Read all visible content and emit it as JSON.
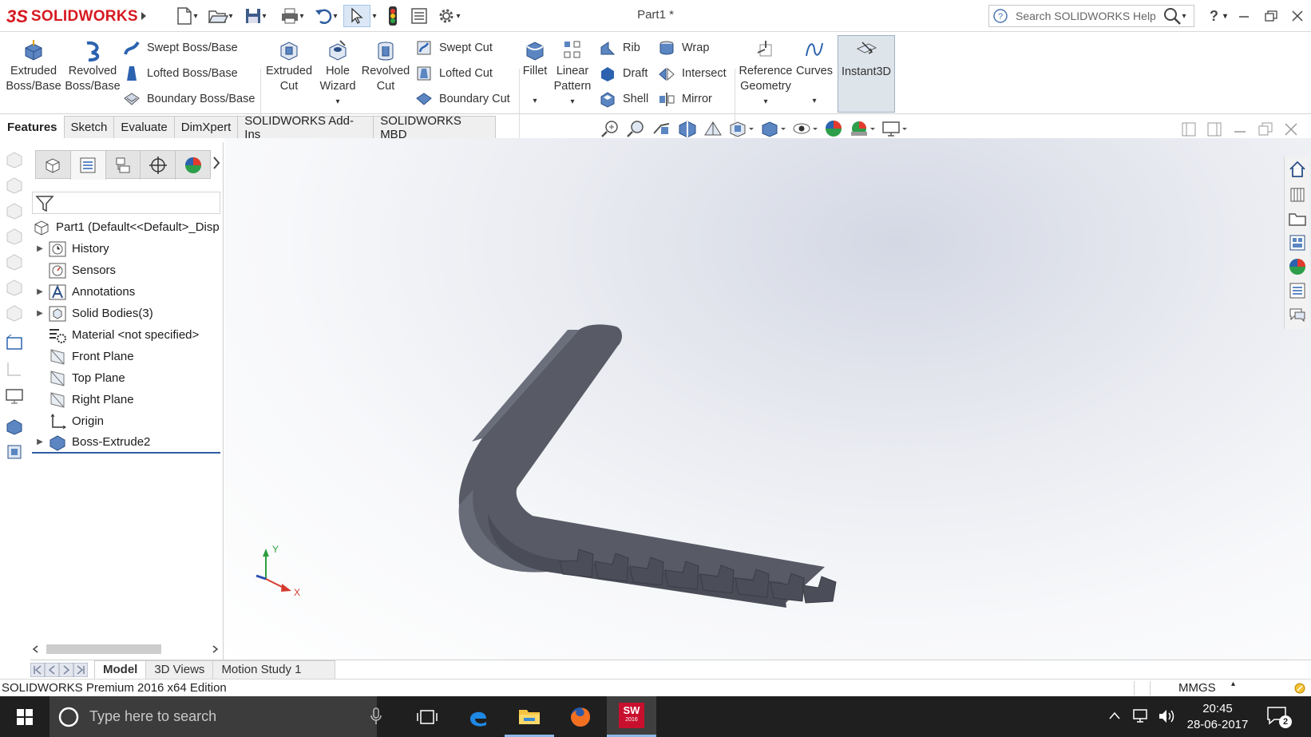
{
  "app": {
    "logo_prefix": "3S",
    "logo_text": "SOLIDWORKS",
    "document_title": "Part1 *",
    "search_placeholder": "Search SOLIDWORKS Help",
    "help_label": "?"
  },
  "ribbon": {
    "extruded_boss": [
      "Extruded",
      "Boss/Base"
    ],
    "revolved_boss": [
      "Revolved",
      "Boss/Base"
    ],
    "swept_boss": "Swept Boss/Base",
    "lofted_boss": "Lofted Boss/Base",
    "boundary_boss": "Boundary Boss/Base",
    "extruded_cut": [
      "Extruded",
      "Cut"
    ],
    "hole_wizard": [
      "Hole",
      "Wizard"
    ],
    "revolved_cut": [
      "Revolved",
      "Cut"
    ],
    "swept_cut": "Swept Cut",
    "lofted_cut": "Lofted Cut",
    "boundary_cut": "Boundary Cut",
    "fillet": "Fillet",
    "linear_pattern": [
      "Linear",
      "Pattern"
    ],
    "rib": "Rib",
    "draft": "Draft",
    "shell": "Shell",
    "wrap": "Wrap",
    "intersect": "Intersect",
    "mirror": "Mirror",
    "reference_geometry": [
      "Reference",
      "Geometry"
    ],
    "curves": "Curves",
    "instant3d": "Instant3D"
  },
  "command_tabs": [
    "Features",
    "Sketch",
    "Evaluate",
    "DimXpert",
    "SOLIDWORKS Add-Ins",
    "SOLIDWORKS MBD"
  ],
  "feature_tree": {
    "root": "Part1  (Default<<Default>_Disp",
    "items": [
      {
        "label": "History",
        "expandable": true,
        "icon": "history-icon"
      },
      {
        "label": "Sensors",
        "expandable": false,
        "icon": "sensors-icon"
      },
      {
        "label": "Annotations",
        "expandable": true,
        "icon": "annotations-icon"
      },
      {
        "label": "Solid Bodies(3)",
        "expandable": true,
        "icon": "solid-bodies-icon"
      },
      {
        "label": "Material <not specified>",
        "expandable": false,
        "icon": "material-icon"
      },
      {
        "label": "Front Plane",
        "expandable": false,
        "icon": "plane-icon"
      },
      {
        "label": "Top Plane",
        "expandable": false,
        "icon": "plane-icon"
      },
      {
        "label": "Right Plane",
        "expandable": false,
        "icon": "plane-icon"
      },
      {
        "label": "Origin",
        "expandable": false,
        "icon": "origin-icon"
      },
      {
        "label": "Boss-Extrude2",
        "expandable": true,
        "icon": "boss-extrude-icon"
      }
    ]
  },
  "triad": {
    "x_label": "X",
    "y_label": "Y"
  },
  "bottom_tabs": [
    "Model",
    "3D Views",
    "Motion Study 1"
  ],
  "status_bar": {
    "edition": "SOLIDWORKS Premium 2016 x64 Edition",
    "units": "MMGS"
  },
  "taskbar": {
    "search_placeholder": "Type here to search",
    "time": "20:45",
    "date": "28-06-2017",
    "notification_count": "2",
    "sw_badge": "SW",
    "sw_year": "2016"
  },
  "colors": {
    "accent": "#d71920",
    "model": "#4a4c57",
    "highlight_button": "#cde4f7"
  }
}
